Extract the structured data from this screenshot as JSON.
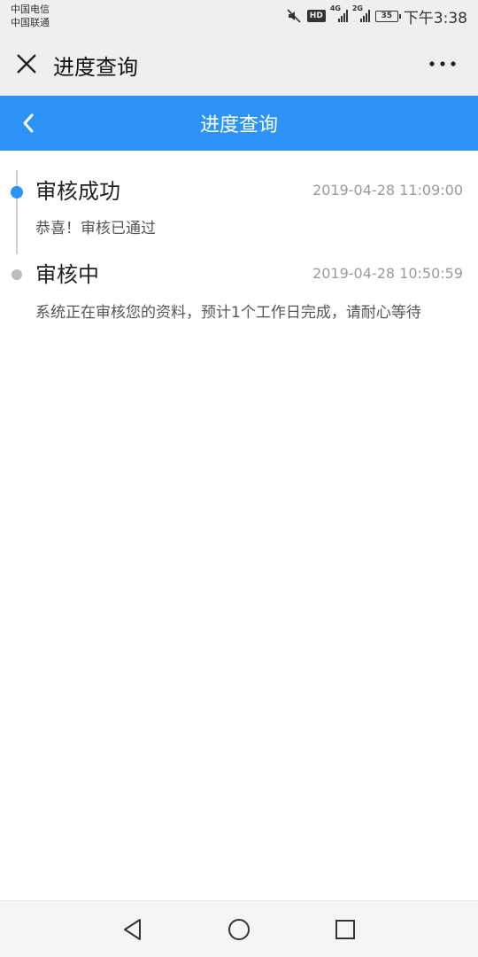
{
  "status_bar": {
    "carrier_1": "中国电信",
    "carrier_2": "中国联通",
    "icons": [
      "mute-icon",
      "hd-icon",
      "4g-signal-icon",
      "2g-signal-icon",
      "battery-icon"
    ],
    "hd_label": "HD",
    "network_1": "4G",
    "network_2": "2G",
    "battery_level": "35",
    "time": "下午3:38"
  },
  "top_bar": {
    "title": "进度查询",
    "close_icon": "close-icon",
    "more_icon": "more-icon"
  },
  "header": {
    "title": "进度查询",
    "back_icon": "chevron-left-icon",
    "color": "#2d93f7"
  },
  "timeline": {
    "items": [
      {
        "title": "审核成功",
        "time": "2019-04-28 11:09:00",
        "desc": "恭喜！审核已通过",
        "state": "active"
      },
      {
        "title": "审核中",
        "time": "2019-04-28 10:50:59",
        "desc": "系统正在审核您的资料，预计1个工作日完成，请耐心等待",
        "state": "done"
      }
    ]
  },
  "nav_bar": {
    "buttons": [
      "back-triangle-icon",
      "home-circle-icon",
      "recents-square-icon"
    ]
  }
}
